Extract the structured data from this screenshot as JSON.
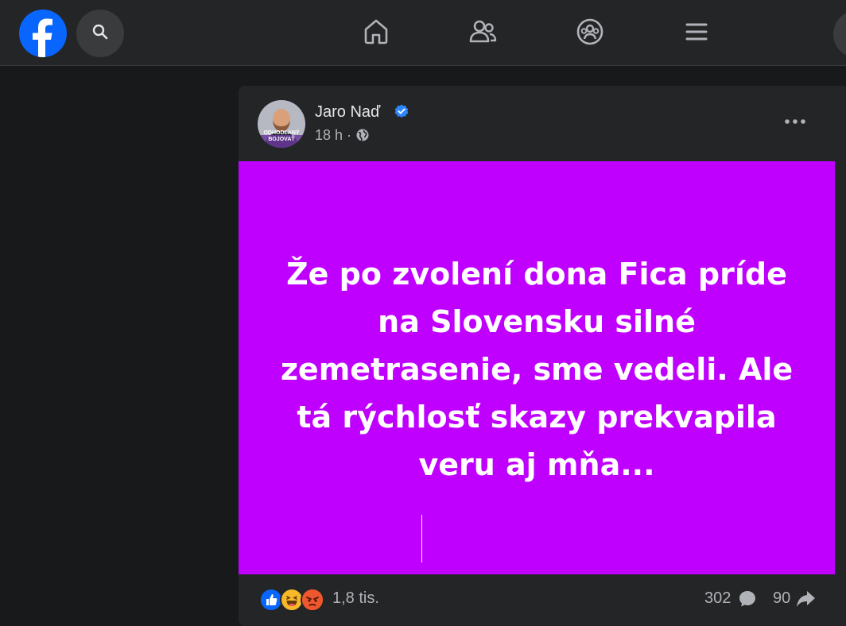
{
  "colors": {
    "brand": "#0866ff",
    "post_background": "#bf00ff",
    "topbar": "#242526",
    "page": "#18191a",
    "verified": "#2d88ff"
  },
  "topbar": {
    "icons": [
      "facebook-logo-icon",
      "search-icon",
      "home-icon",
      "friends-icon",
      "groups-icon",
      "menu-icon"
    ]
  },
  "post": {
    "author": "Jaro Naď",
    "time": "18 h",
    "separator": "·",
    "avatar_caption_line1": "ODHODLANÝ",
    "avatar_caption_line2": "BOJOVAŤ",
    "text_lines": [
      "Že po zvolení dona Fica príde",
      "na Slovensku silné",
      "zemetrasenie, sme vedeli. Ale",
      "tá rýchlosť skazy prekvapila",
      "veru aj mňa..."
    ],
    "reactions": [
      "like",
      "haha",
      "angry"
    ],
    "reaction_count": "1,8 tis.",
    "comment_count": "302",
    "share_count": "90"
  }
}
